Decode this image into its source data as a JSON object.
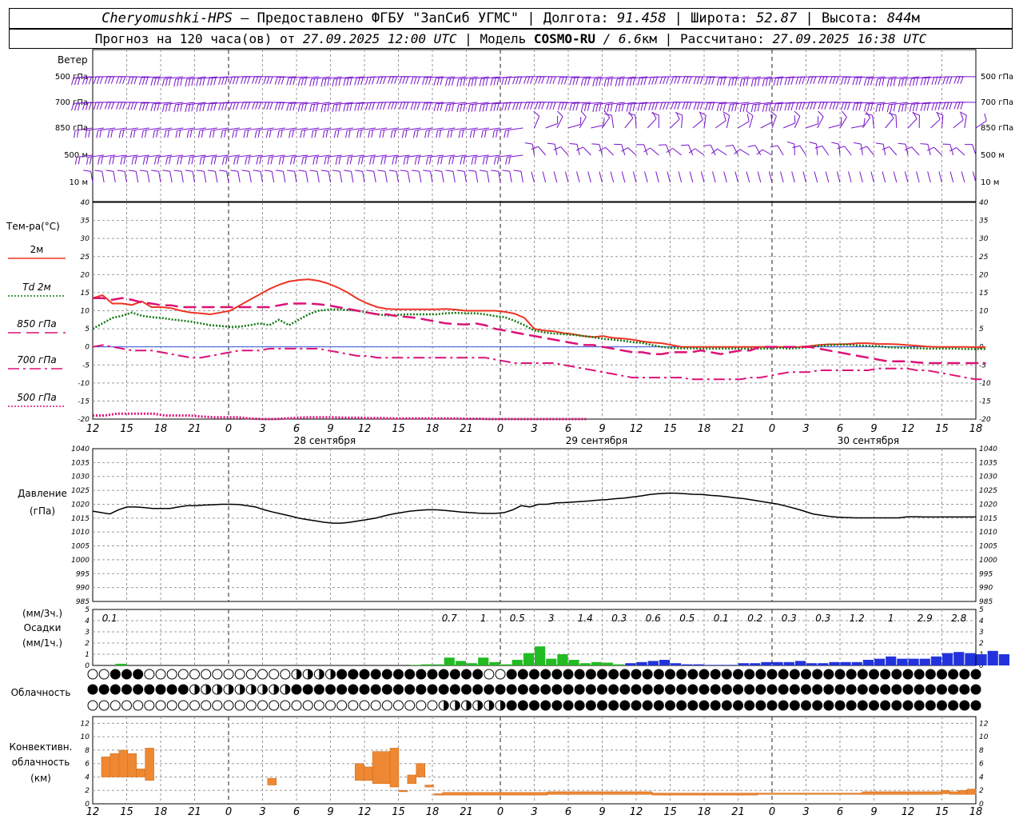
{
  "header": {
    "station": "Cheryomushki-HPS",
    "provider": " – Предоставлено ФГБУ \"ЗапСиб УГМС\"",
    "lon_label": "Долгота:",
    "lon": "91.458",
    "lat_label": "Широта:",
    "lat": "52.87",
    "alt_label": "Высота:",
    "alt": "844",
    "alt_unit": "м",
    "forecast_label": "Прогноз на 120 часа(ов) от",
    "forecast_start": "27.09.2025 12:00 UTC",
    "model_label": "Модель",
    "model": "COSMO-RU",
    "resolution": "/ 6.6",
    "resolution_unit": "км",
    "calc_label": "Рассчитано:",
    "calc_time": "27.09.2025 16:38 UTC"
  },
  "wind_panel": {
    "title": "Ветер",
    "levels": [
      "500 гПа",
      "700 гПа",
      "850 гПа",
      "500 м",
      "10  м"
    ]
  },
  "temp_panel": {
    "title": "Тем-ра(°С)",
    "legend": [
      {
        "label": "2м",
        "color": "#ee3322",
        "style": "solid"
      },
      {
        "label": "Td 2м",
        "color": "#117711",
        "style": "dotted"
      },
      {
        "label": "850 гПа",
        "color": "#dd1177",
        "style": "dashed"
      },
      {
        "label": "700 гПа",
        "color": "#dd1177",
        "style": "dashdot"
      },
      {
        "label": "500 гПа",
        "color": "#dd1177",
        "style": "dotted"
      }
    ]
  },
  "pressure_panel": {
    "title": "Давление",
    "unit": "(гПа)"
  },
  "precip_panel": {
    "unit3": "(мм/3ч.)",
    "title": "Осадки",
    "unit1": "(мм/1ч.)",
    "totals": [
      "0.1",
      "",
      "",
      "",
      "",
      "",
      "",
      "",
      "",
      "",
      "0.7",
      "1",
      "0.5",
      "3",
      "1.4",
      "0.3",
      "0.6",
      "0.5",
      "0.1",
      "0.2",
      "0.3",
      "0.3",
      "1.2",
      "1",
      "2.9",
      "2.8"
    ]
  },
  "cloud_panel": {
    "title": "Облачность"
  },
  "conv_panel": {
    "title1": "Конвективн.",
    "title2": "облачность",
    "unit": "(км)"
  },
  "time_axis": {
    "hour_labels": [
      "12",
      "15",
      "18",
      "21",
      "0",
      "3",
      "6",
      "9",
      "12",
      "15",
      "18",
      "21",
      "0",
      "3",
      "6",
      "9",
      "12",
      "15",
      "18",
      "21",
      "0",
      "3",
      "6",
      "9",
      "12",
      "15",
      "18"
    ],
    "days": [
      "28 сентября",
      "29 сентября",
      "30 сентября"
    ]
  },
  "colors": {
    "wind": "#7711cc",
    "grid": "#999999",
    "temp2m": "#ee3322",
    "td2m": "#117711",
    "upper": "#dd1177",
    "pressure": "#000000",
    "precip_conv": "#22bb22",
    "precip_strat": "#2233dd",
    "conv_cloud": "#ee8833"
  },
  "chart_data": [
    {
      "type": "line",
      "title": "Тем-ра(°С)",
      "x_hours": [
        0,
        1,
        2,
        3,
        4,
        5,
        6,
        7,
        8,
        9,
        10,
        11,
        12,
        13,
        14,
        15,
        16,
        17,
        18,
        19,
        20,
        21,
        22,
        23,
        24,
        25,
        26,
        27,
        28,
        29,
        30,
        31,
        32,
        33,
        34,
        35,
        36,
        37,
        38,
        39,
        40,
        41,
        42,
        43,
        44,
        45,
        46,
        47,
        48,
        49,
        50,
        51,
        52,
        53,
        54,
        55,
        56,
        57,
        58,
        59,
        60,
        61,
        62,
        63,
        64,
        65,
        66,
        67,
        68,
        69,
        70,
        71,
        72,
        73,
        74,
        75,
        76,
        77,
        78,
        79,
        80,
        81,
        82,
        83,
        84,
        85,
        86,
        87,
        88,
        89,
        90,
        91,
        92,
        93,
        94,
        95,
        96,
        97,
        98,
        99,
        100,
        101,
        102,
        103,
        104,
        105,
        106,
        107,
        108,
        109,
        110,
        111,
        112,
        113,
        114,
        115,
        116,
        117,
        118,
        119,
        120,
        121,
        122,
        123,
        124,
        125,
        126,
        127,
        128,
        129,
        130,
        131,
        132,
        133,
        134,
        135,
        136,
        137,
        138,
        139,
        140,
        141,
        142,
        143,
        144,
        145,
        146,
        147,
        148,
        149,
        150,
        151,
        152,
        153,
        154,
        155,
        156,
        157,
        158
      ],
      "ylim": [
        -20,
        40
      ],
      "series": [
        {
          "name": "2м",
          "values": [
            13.5,
            14.3,
            12,
            12,
            11.6,
            12.6,
            11,
            11,
            10.7,
            10,
            9.5,
            9.3,
            9.0,
            9.5,
            10,
            11.5,
            13,
            14.5,
            16,
            17.2,
            18.1,
            18.5,
            18.7,
            18.3,
            17.5,
            16.4,
            15.0,
            13.3,
            12.0,
            11.0,
            10.5,
            10.4,
            10.4,
            10.4,
            10.4,
            10.4,
            10.5,
            10.3,
            10.0,
            10.0,
            10.0,
            10.0,
            9.7,
            9.2,
            8.0,
            5.0,
            4.5,
            4.3,
            3.8,
            3.5,
            3.0,
            2.7,
            3.0,
            2.5,
            2.3,
            2.0,
            1.5,
            1.2,
            1.0,
            0.5,
            0.0,
            0.0,
            0.0,
            0.0,
            0.0,
            0.0,
            0.0,
            0.0,
            0.0,
            0.0,
            0.0,
            -0.1,
            0.0,
            0.2,
            0.5,
            0.7,
            0.7,
            0.8,
            1.0,
            1.0,
            0.8,
            0.8,
            0.7,
            0.5,
            0.3,
            0.1,
            0.0,
            0.0,
            0.0,
            0.0,
            -0.1,
            -0.1
          ]
        },
        {
          "name": "Td 2м",
          "values": [
            5,
            6.5,
            8,
            8.6,
            9.5,
            8.6,
            8.2,
            8,
            7.6,
            7.3,
            7,
            6.5,
            6.0,
            5.8,
            5.5,
            5.6,
            6.0,
            6.5,
            6.0,
            7.5,
            6.0,
            7.5,
            9.0,
            10.0,
            10.3,
            10.4,
            10.2,
            10.0,
            9.5,
            9.0,
            8.7,
            8.8,
            9.0,
            9.0,
            9.0,
            9.0,
            9.3,
            9.4,
            9.3,
            9.3,
            9.0,
            8.5,
            8.2,
            7.2,
            6.0,
            4.5,
            4.0,
            3.7,
            3.5,
            3.3,
            3.0,
            2.7,
            2.2,
            2.0,
            1.7,
            1.3,
            1.1,
            0.5,
            0.0,
            -0.3,
            -0.4,
            -0.4,
            -0.5,
            -0.5,
            -0.5,
            -0.5,
            -0.5,
            -0.5,
            -0.5,
            -0.5,
            -0.3,
            -0.5,
            -0.3,
            0.0,
            0.3,
            0.5,
            0.6,
            0.6,
            0.4,
            0.3,
            0.2,
            -0.1,
            -0.2,
            -0.3,
            -0.4,
            -0.5,
            -0.5,
            -0.5,
            -0.5,
            -0.6,
            -0.6,
            -0.6
          ]
        },
        {
          "name": "850 гПа",
          "values": [
            13.5,
            13.5,
            13,
            13.5,
            13,
            12.3,
            12,
            11.5,
            11.5,
            11,
            11,
            11,
            11,
            11,
            11,
            11,
            11,
            11,
            11,
            11.5,
            12,
            12,
            12,
            11.8,
            11.5,
            11,
            10.5,
            10,
            9.5,
            9.0,
            9.0,
            8.5,
            8.3,
            8.0,
            7.5,
            7.0,
            6.5,
            6.3,
            6.2,
            6.5,
            6.0,
            5.0,
            4.5,
            4.0,
            3.5,
            3.0,
            2.5,
            2.0,
            1.5,
            1.0,
            0.5,
            0.5,
            0.0,
            -0.5,
            -1.0,
            -1.5,
            -1.5,
            -2.0,
            -2.0,
            -1.5,
            -1.5,
            -1.5,
            -1.0,
            -1.5,
            -2.0,
            -1.5,
            -1.0,
            -1.0,
            0.0,
            0.0,
            0.0,
            0.0,
            0.0,
            0.0,
            -0.5,
            -1.0,
            -1.5,
            -2.0,
            -2.5,
            -3.0,
            -3.5,
            -4.0,
            -4.0,
            -4.0,
            -4.3,
            -4.5,
            -4.5,
            -4.5,
            -4.5,
            -4.5,
            -4.5,
            -4.5
          ]
        },
        {
          "name": "700 гПа",
          "values": [
            0,
            0.5,
            0,
            -0.5,
            -1,
            -1,
            -1,
            -1.5,
            -2,
            -2.5,
            -3,
            -3,
            -2.5,
            -2,
            -1.5,
            -1,
            -1,
            -1,
            -0.5,
            -0.5,
            -0.5,
            -0.5,
            -0.5,
            -0.5,
            -1.0,
            -1.5,
            -2.0,
            -2.5,
            -2.5,
            -3.0,
            -3.0,
            -3.0,
            -3.0,
            -3.0,
            -3.0,
            -3.0,
            -3.0,
            -3.0,
            -3.0,
            -3.0,
            -3.0,
            -3.5,
            -4.0,
            -4.5,
            -4.5,
            -4.5,
            -4.5,
            -4.5,
            -5.0,
            -5.5,
            -6.0,
            -6.5,
            -7.0,
            -7.5,
            -8.0,
            -8.5,
            -8.5,
            -8.5,
            -8.5,
            -8.5,
            -8.5,
            -9.0,
            -9.0,
            -9.0,
            -9.0,
            -9.0,
            -9.0,
            -8.5,
            -8.5,
            -8.0,
            -7.5,
            -7.0,
            -7.0,
            -7.0,
            -6.5,
            -6.5,
            -6.5,
            -6.5,
            -6.5,
            -6.5,
            -6.0,
            -6.0,
            -6.0,
            -6.0,
            -6.5,
            -6.5,
            -7.0,
            -7.5,
            -8.0,
            -8.5,
            -9.0,
            -9.0
          ]
        },
        {
          "name": "500 гПа",
          "values": [
            -19,
            -19,
            -18.5,
            -18.5,
            -18.5,
            -18.5,
            -19,
            -19,
            -19,
            -19.3,
            -19.5,
            -19.5,
            -19.5,
            -19.8,
            -20,
            -20,
            -19.8,
            -19.6,
            -19.5,
            -19.5,
            -19.5,
            -19.6,
            -19.6,
            -19.7,
            -19.7,
            -19.8,
            -19.8,
            -19.8,
            -19.8,
            -19.8,
            -19.8,
            -19.9,
            -19.9,
            -20,
            -20,
            -20,
            -20,
            -20,
            -20,
            -20,
            -20,
            -20
          ]
        }
      ]
    },
    {
      "type": "line",
      "title": "Давление",
      "ylabel": "(гПа)",
      "ylim": [
        985,
        1040
      ],
      "series": [
        {
          "name": "Давление",
          "values": [
            1017.5,
            1017,
            1016.5,
            1018,
            1019,
            1019,
            1018.8,
            1018.5,
            1018.5,
            1018.5,
            1019.0,
            1019.5,
            1019.5,
            1019.7,
            1019.8,
            1020,
            1020,
            1019.9,
            1019.5,
            1019.0,
            1018.0,
            1017.2,
            1016.5,
            1015.8,
            1015.0,
            1014.5,
            1014,
            1013.5,
            1013.2,
            1013.2,
            1013.5,
            1014,
            1014.5,
            1015,
            1015.8,
            1016.5,
            1017,
            1017.5,
            1017.8,
            1018,
            1018,
            1017.8,
            1017.5,
            1017.2,
            1017.0,
            1016.8,
            1016.7,
            1016.7,
            1017.0,
            1018.0,
            1019.5,
            1019,
            1020,
            1020,
            1020.5,
            1020.6,
            1020.8,
            1021.0,
            1021.2,
            1021.5,
            1021.7,
            1022.0,
            1022.2,
            1022.6,
            1023.0,
            1023.5,
            1023.8,
            1024.0,
            1024.0,
            1023.8,
            1023.6,
            1023.5,
            1023.2,
            1023.0,
            1022.7,
            1022.3,
            1022.0,
            1021.5,
            1021.0,
            1020.5,
            1020.0,
            1019.2,
            1018.4,
            1017.5,
            1016.5,
            1016.0,
            1015.6,
            1015.3,
            1015.2,
            1015.1,
            1015.1,
            1015.1,
            1015.1,
            1015.1,
            1015.1,
            1015.5,
            1015.5,
            1015.4,
            1015.4,
            1015.4,
            1015.4,
            1015.4,
            1015.4,
            1015.4
          ]
        }
      ]
    },
    {
      "type": "bar",
      "title": "Осадки",
      "ylabel": "(мм/1ч.)",
      "ylim": [
        0,
        5
      ],
      "totals_3h": [
        "0.1",
        "",
        "",
        "",
        "",
        "",
        "",
        "",
        "",
        "",
        "0.7",
        "1",
        "0.5",
        "3",
        "1.4",
        "0.3",
        "0.6",
        "0.5",
        "0.1",
        "0.2",
        "0.3",
        "0.3",
        "1.2",
        "1",
        "2.9",
        "2.8"
      ],
      "series": [
        {
          "name": "conv",
          "start_hour": 28,
          "values": [
            0.05,
            0.1,
            0.1,
            0.7,
            0.4,
            0.2,
            0.7,
            0.3,
            0.1,
            0.5,
            1.1,
            1.7,
            0.6,
            1.0,
            0.5,
            0.2,
            0.3,
            0.25,
            0.1
          ]
        },
        {
          "name": "strat",
          "start_hour": 47,
          "values": [
            0.2,
            0.3,
            0.4,
            0.5,
            0.2,
            0.1,
            0.1,
            0.05,
            0.05,
            0.05,
            0.2,
            0.2,
            0.3,
            0.3,
            0.3,
            0.4,
            0.2,
            0.2,
            0.3,
            0.3,
            0.3,
            0.5,
            0.6,
            0.8,
            0.6,
            0.6,
            0.6,
            0.8,
            1.1,
            1.2,
            1.1,
            1.0,
            1.3,
            1.0
          ]
        }
      ]
    },
    {
      "type": "bar",
      "title": "Конвективн. облачность",
      "ylabel": "(км)",
      "ylim": [
        0,
        13
      ],
      "bars": [
        {
          "x": 1,
          "w": 1,
          "top": 7.0,
          "bot": 4.0
        },
        {
          "x": 2,
          "w": 1,
          "top": 7.5,
          "bot": 4.0
        },
        {
          "x": 3,
          "w": 1,
          "top": 8.0,
          "bot": 4.0
        },
        {
          "x": 4,
          "w": 1,
          "top": 7.5,
          "bot": 4.0
        },
        {
          "x": 5,
          "w": 1,
          "top": 5.2,
          "bot": 4.0
        },
        {
          "x": 6,
          "w": 1,
          "top": 8.3,
          "bot": 3.5
        },
        {
          "x": 20,
          "w": 1,
          "top": 3.8,
          "bot": 2.8
        },
        {
          "x": 30,
          "w": 1,
          "top": 6.0,
          "bot": 3.5
        },
        {
          "x": 31,
          "w": 1,
          "top": 5.5,
          "bot": 3.5
        },
        {
          "x": 32,
          "w": 2,
          "top": 7.8,
          "bot": 3.0
        },
        {
          "x": 34,
          "w": 1,
          "top": 8.3,
          "bot": 2.5
        },
        {
          "x": 35,
          "w": 1,
          "top": 2.0,
          "bot": 1.8
        },
        {
          "x": 36,
          "w": 1,
          "top": 4.3,
          "bot": 3.0
        },
        {
          "x": 37,
          "w": 1,
          "top": 6.0,
          "bot": 4.0
        },
        {
          "x": 38,
          "w": 1,
          "top": 2.8,
          "bot": 2.5
        },
        {
          "x": 39,
          "w": 1,
          "top": 1.5,
          "bot": 1.3
        },
        {
          "x": 40,
          "w": 12,
          "top": 1.7,
          "bot": 1.3
        },
        {
          "x": 52,
          "w": 12,
          "top": 1.8,
          "bot": 1.4
        },
        {
          "x": 64,
          "w": 12,
          "top": 1.6,
          "bot": 1.3
        },
        {
          "x": 76,
          "w": 12,
          "top": 1.6,
          "bot": 1.4
        },
        {
          "x": 88,
          "w": 9,
          "top": 1.8,
          "bot": 1.4
        },
        {
          "x": 97,
          "w": 1,
          "top": 2.0,
          "bot": 1.5
        },
        {
          "x": 98,
          "w": 1,
          "top": 1.8,
          "bot": 1.4
        },
        {
          "x": 99,
          "w": 1,
          "top": 2.0,
          "bot": 1.4
        },
        {
          "x": 100,
          "w": 1,
          "top": 2.2,
          "bot": 1.4
        }
      ]
    }
  ]
}
